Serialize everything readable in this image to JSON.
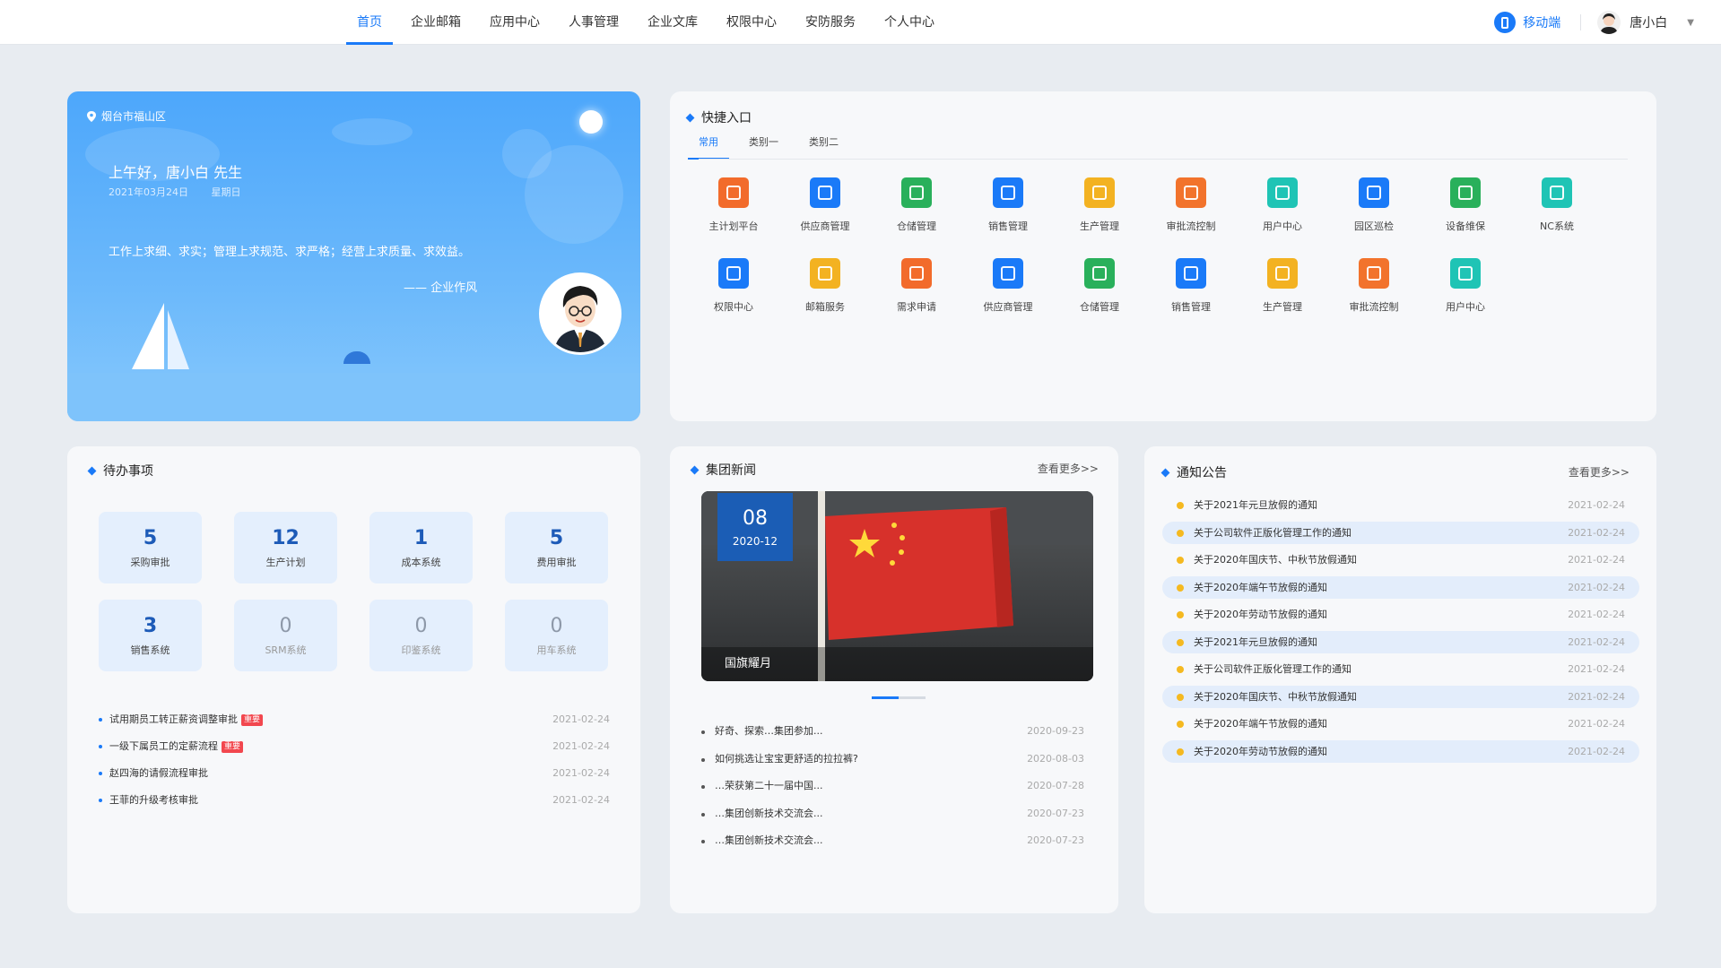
{
  "nav": {
    "items": [
      "首页",
      "企业邮箱",
      "应用中心",
      "人事管理",
      "企业文库",
      "权限中心",
      "安防服务",
      "个人中心"
    ],
    "active_index": 0
  },
  "topright": {
    "mobile_label": "移动端",
    "user_name": "唐小白"
  },
  "welcome": {
    "location": "烟台市福山区",
    "greeting": "上午好，唐小白  先生",
    "date": "2021年03月24日",
    "weekday": "星期日",
    "motto": "工作上求细、求实；管理上求规范、求严格；经营上求质量、求效益。",
    "signature": "—— 企业作风"
  },
  "quick": {
    "title": "快捷入口",
    "tabs": [
      "常用",
      "类别一",
      "类别二"
    ],
    "items": [
      {
        "label": "主计划平台",
        "color": "#f26b2b",
        "icon": "network-icon"
      },
      {
        "label": "供应商管理",
        "color": "#1a7af8",
        "icon": "supplier-icon"
      },
      {
        "label": "仓储管理",
        "color": "#29b05b",
        "icon": "tools-icon"
      },
      {
        "label": "销售管理",
        "color": "#1a7af8",
        "icon": "document-icon"
      },
      {
        "label": "生产管理",
        "color": "#f3b221",
        "icon": "edit-icon"
      },
      {
        "label": "审批流控制",
        "color": "#f2732c",
        "icon": "approval-icon"
      },
      {
        "label": "用户中心",
        "color": "#1fc4b5",
        "icon": "users-icon"
      },
      {
        "label": "园区巡检",
        "color": "#1a7af8",
        "icon": "inspection-icon"
      },
      {
        "label": "设备维保",
        "color": "#29b05b",
        "icon": "maintenance-icon"
      },
      {
        "label": "NC系统",
        "color": "#1fc4b5",
        "icon": "nc-icon"
      },
      {
        "label": "权限中心",
        "color": "#1a7af8",
        "icon": "permission-icon"
      },
      {
        "label": "邮箱服务",
        "color": "#f3b221",
        "icon": "mail-icon"
      },
      {
        "label": "需求申请",
        "color": "#f26b2b",
        "icon": "request-icon"
      },
      {
        "label": "供应商管理",
        "color": "#1a7af8",
        "icon": "supplier-icon"
      },
      {
        "label": "仓储管理",
        "color": "#29b05b",
        "icon": "tools-icon"
      },
      {
        "label": "销售管理",
        "color": "#1a7af8",
        "icon": "document-icon"
      },
      {
        "label": "生产管理",
        "color": "#f3b221",
        "icon": "edit-icon"
      },
      {
        "label": "审批流控制",
        "color": "#f2732c",
        "icon": "approval-icon"
      },
      {
        "label": "用户中心",
        "color": "#1fc4b5",
        "icon": "users-icon"
      }
    ]
  },
  "todo": {
    "title": "待办事项",
    "stats": [
      {
        "num": "5",
        "label": "采购审批",
        "zero": false
      },
      {
        "num": "12",
        "label": "生产计划",
        "zero": false
      },
      {
        "num": "1",
        "label": "成本系统",
        "zero": false
      },
      {
        "num": "5",
        "label": "费用审批",
        "zero": false
      },
      {
        "num": "3",
        "label": "销售系统",
        "zero": false
      },
      {
        "num": "0",
        "label": "SRM系统",
        "zero": true
      },
      {
        "num": "0",
        "label": "印鉴系统",
        "zero": true
      },
      {
        "num": "0",
        "label": "用车系统",
        "zero": true
      }
    ],
    "items": [
      {
        "text": "试用期员工转正薪资调整审批",
        "tag": "重要",
        "date": "2021-02-24"
      },
      {
        "text": "一级下属员工的定薪流程",
        "tag": "重要",
        "date": "2021-02-24"
      },
      {
        "text": "赵四海的请假流程审批",
        "tag": "",
        "date": "2021-02-24"
      },
      {
        "text": "王菲的升级考核审批",
        "tag": "",
        "date": "2021-02-24"
      }
    ]
  },
  "news": {
    "title": "集团新闻",
    "more": "查看更多>>",
    "featured": {
      "day": "08",
      "year_month": "2020-12",
      "caption": "国旗耀月"
    },
    "items": [
      {
        "text": "好奇、探索…集团参加...",
        "date": "2020-09-23"
      },
      {
        "text": "如何挑选让宝宝更舒适的拉拉裤?",
        "date": "2020-08-03"
      },
      {
        "text": "…荣获第二十一届中国...",
        "date": "2020-07-28"
      },
      {
        "text": "…集团创新技术交流会...",
        "date": "2020-07-23"
      },
      {
        "text": "…集团创新技术交流会...",
        "date": "2020-07-23"
      }
    ]
  },
  "notice": {
    "title": "通知公告",
    "more": "查看更多>>",
    "items": [
      {
        "text": "关于2021年元旦放假的通知",
        "date": "2021-02-24"
      },
      {
        "text": "关于公司软件正版化管理工作的通知",
        "date": "2021-02-24"
      },
      {
        "text": "关于2020年国庆节、中秋节放假通知",
        "date": "2021-02-24"
      },
      {
        "text": "关于2020年端午节放假的通知",
        "date": "2021-02-24"
      },
      {
        "text": "关于2020年劳动节放假的通知",
        "date": "2021-02-24"
      },
      {
        "text": "关于2021年元旦放假的通知",
        "date": "2021-02-24"
      },
      {
        "text": "关于公司软件正版化管理工作的通知",
        "date": "2021-02-24"
      },
      {
        "text": "关于2020年国庆节、中秋节放假通知",
        "date": "2021-02-24"
      },
      {
        "text": "关于2020年端午节放假的通知",
        "date": "2021-02-24"
      },
      {
        "text": "关于2020年劳动节放假的通知",
        "date": "2021-02-24"
      }
    ]
  }
}
